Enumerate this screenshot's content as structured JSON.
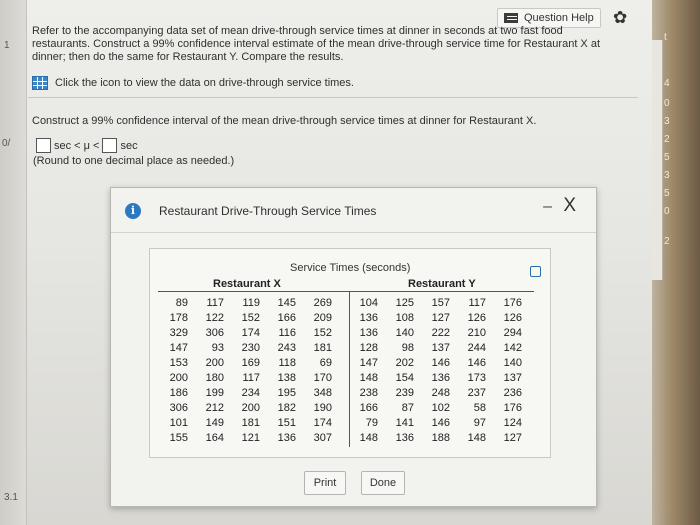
{
  "toolbar": {
    "question_help_label": "Question Help"
  },
  "question": {
    "text_line1": "Refer to the accompanying data set of mean drive-through service times at dinner in seconds at two fast food",
    "text_line2": "restaurants. Construct a 99% confidence interval estimate of the mean drive-through service time for Restaurant X at",
    "text_line3": "dinner; then do the same for Restaurant Y. Compare the results.",
    "data_link_label": "Click the icon to view the data on drive-through service times."
  },
  "prompt": {
    "text": "Construct a 99% confidence interval of the mean drive-through service times at dinner for Restaurant X.",
    "ci_left_unit": "sec < μ <",
    "ci_right_unit": "sec",
    "round_note": "(Round to one decimal place as needed.)"
  },
  "left_strip": {
    "marks": [
      "1",
      "0/",
      "3.1"
    ]
  },
  "right_strip": {
    "marks": [
      "t",
      "4",
      "0",
      "3",
      "2",
      "5",
      "3",
      "5",
      "0",
      "2"
    ]
  },
  "modal": {
    "title": "Restaurant Drive-Through Service Times",
    "minimize": "–",
    "close": "X",
    "table_title": "Service Times (seconds)",
    "header_x": "Restaurant X",
    "header_y": "Restaurant Y",
    "rows": [
      [
        "89",
        "117",
        "119",
        "145",
        "269",
        "104",
        "125",
        "157",
        "117",
        "176"
      ],
      [
        "178",
        "122",
        "152",
        "166",
        "209",
        "136",
        "108",
        "127",
        "126",
        "126"
      ],
      [
        "329",
        "306",
        "174",
        "116",
        "152",
        "136",
        "140",
        "222",
        "210",
        "294"
      ],
      [
        "147",
        "93",
        "230",
        "243",
        "181",
        "128",
        "98",
        "137",
        "244",
        "142"
      ],
      [
        "153",
        "200",
        "169",
        "118",
        "69",
        "147",
        "202",
        "146",
        "146",
        "140"
      ],
      [
        "200",
        "180",
        "117",
        "138",
        "170",
        "148",
        "154",
        "136",
        "173",
        "137"
      ],
      [
        "186",
        "199",
        "234",
        "195",
        "348",
        "238",
        "239",
        "248",
        "237",
        "236"
      ],
      [
        "306",
        "212",
        "200",
        "182",
        "190",
        "166",
        "87",
        "102",
        "58",
        "176"
      ],
      [
        "101",
        "149",
        "181",
        "151",
        "174",
        "79",
        "141",
        "146",
        "97",
        "124"
      ],
      [
        "155",
        "164",
        "121",
        "136",
        "307",
        "148",
        "136",
        "188",
        "148",
        "127"
      ]
    ],
    "print_label": "Print",
    "done_label": "Done"
  },
  "colors": {
    "accent": "#2a79c2",
    "background": "#e8e8e4"
  }
}
